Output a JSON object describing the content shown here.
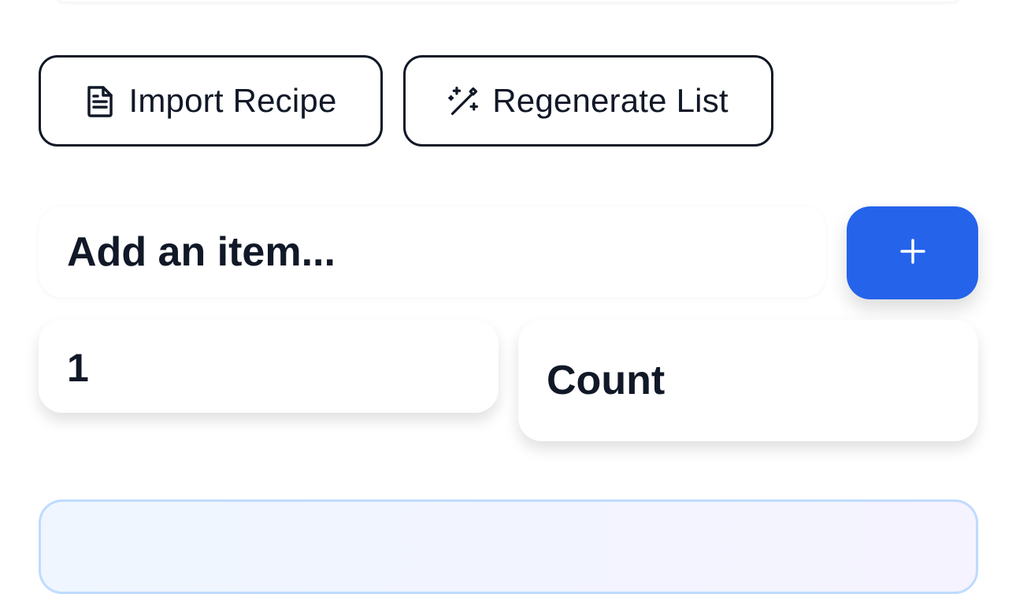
{
  "actions": {
    "import_label": "Import Recipe",
    "import_icon": "document-icon",
    "regenerate_label": "Regenerate List",
    "regenerate_icon": "magic-wand-icon"
  },
  "add_item": {
    "item_placeholder": "Add an item...",
    "quantity_value": "1",
    "unit_value": "Count",
    "add_button_icon": "plus-icon"
  },
  "colors": {
    "accent": "#2563eb",
    "border_dark": "#111827",
    "card_border": "#bfdbfe"
  }
}
